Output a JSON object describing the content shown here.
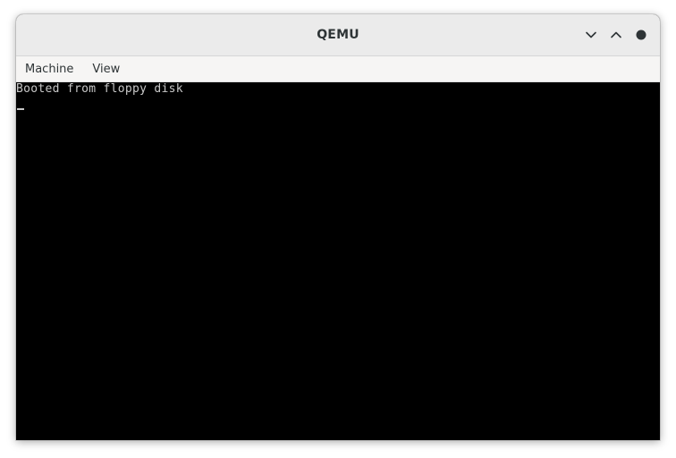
{
  "window": {
    "title": "QEMU"
  },
  "controls": {
    "minimize_icon": "chevron-down-icon",
    "maximize_icon": "chevron-up-icon",
    "close_icon": "close-dot-icon"
  },
  "menu": {
    "items": [
      {
        "label": "Machine"
      },
      {
        "label": "View"
      }
    ]
  },
  "console": {
    "lines": [
      "Booted from floppy disk"
    ],
    "text_color": "#c8c8c8",
    "background": "#000000"
  }
}
